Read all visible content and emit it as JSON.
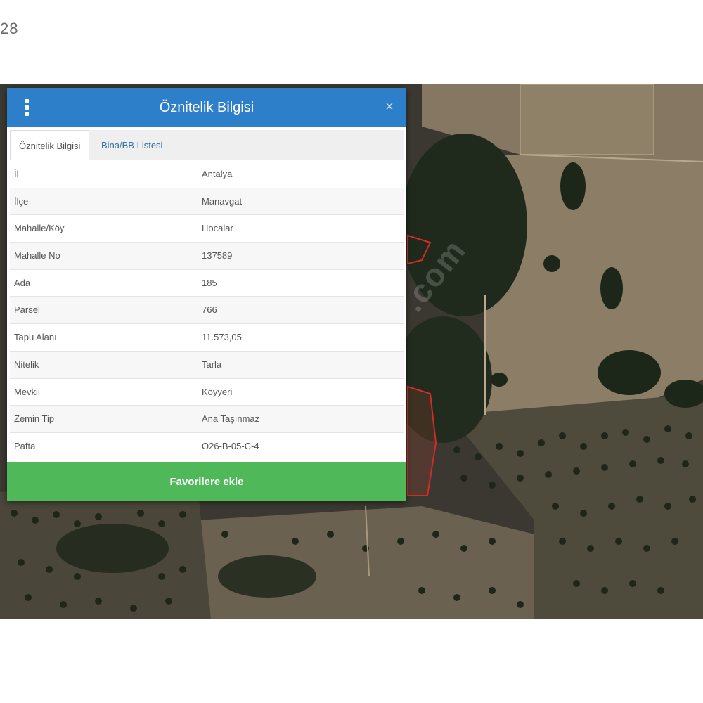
{
  "corner_text": "28",
  "dialog": {
    "title": "Öznitelik Bilgisi",
    "close_symbol": "×",
    "tabs": [
      {
        "label": "Öznitelik Bilgisi",
        "active": true
      },
      {
        "label": "Bina/BB Listesi",
        "active": false
      }
    ],
    "rows": [
      {
        "label": "İl",
        "value": "Antalya"
      },
      {
        "label": "İlçe",
        "value": "Manavgat"
      },
      {
        "label": "Mahalle/Köy",
        "value": "Hocalar"
      },
      {
        "label": "Mahalle No",
        "value": "137589"
      },
      {
        "label": "Ada",
        "value": "185"
      },
      {
        "label": "Parsel",
        "value": "766"
      },
      {
        "label": "Tapu Alanı",
        "value": "11.573,05"
      },
      {
        "label": "Nitelik",
        "value": "Tarla"
      },
      {
        "label": "Mevkii",
        "value": "Köyyeri"
      },
      {
        "label": "Zemin Tip",
        "value": "Ana Taşınmaz"
      },
      {
        "label": "Pafta",
        "value": "O26-B-05-C-4"
      }
    ],
    "favorite_button": "Favorilere ekle"
  },
  "icons": {
    "menu": "vertical-dots-icon",
    "close": "close-icon"
  },
  "colors": {
    "header": "#2e7fc9",
    "button": "#4fb95a",
    "parcel_outline": "#d42a2a"
  }
}
